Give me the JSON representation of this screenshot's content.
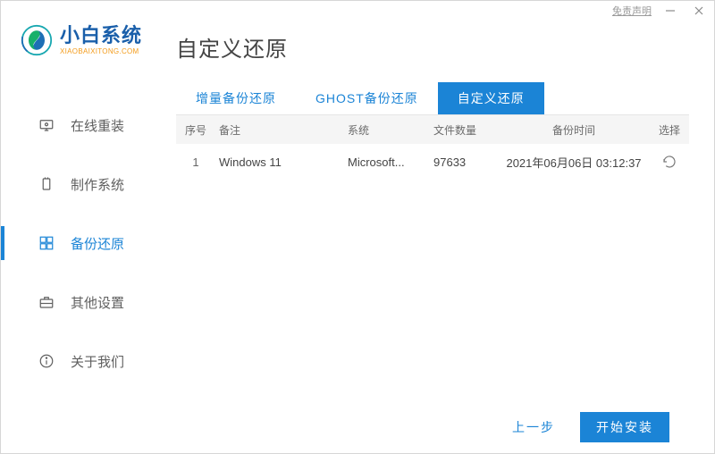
{
  "titlebar": {
    "disclaimer": "免责声明"
  },
  "brand": {
    "title": "小白系统",
    "subtitle": "XIAOBAIXITONG.COM"
  },
  "nav": {
    "items": [
      {
        "label": "在线重装"
      },
      {
        "label": "制作系统"
      },
      {
        "label": "备份还原"
      },
      {
        "label": "其他设置"
      },
      {
        "label": "关于我们"
      }
    ]
  },
  "page": {
    "title": "自定义还原"
  },
  "tabs": [
    {
      "label": "增量备份还原"
    },
    {
      "label": "GHOST备份还原"
    },
    {
      "label": "自定义还原"
    }
  ],
  "table": {
    "headers": {
      "idx": "序号",
      "note": "备注",
      "sys": "系统",
      "files": "文件数量",
      "time": "备份时间",
      "sel": "选择"
    },
    "rows": [
      {
        "idx": "1",
        "note": "Windows 11",
        "sys": "Microsoft...",
        "files": "97633",
        "time": "2021年06月06日 03:12:37"
      }
    ]
  },
  "footer": {
    "back": "上一步",
    "start": "开始安装"
  }
}
